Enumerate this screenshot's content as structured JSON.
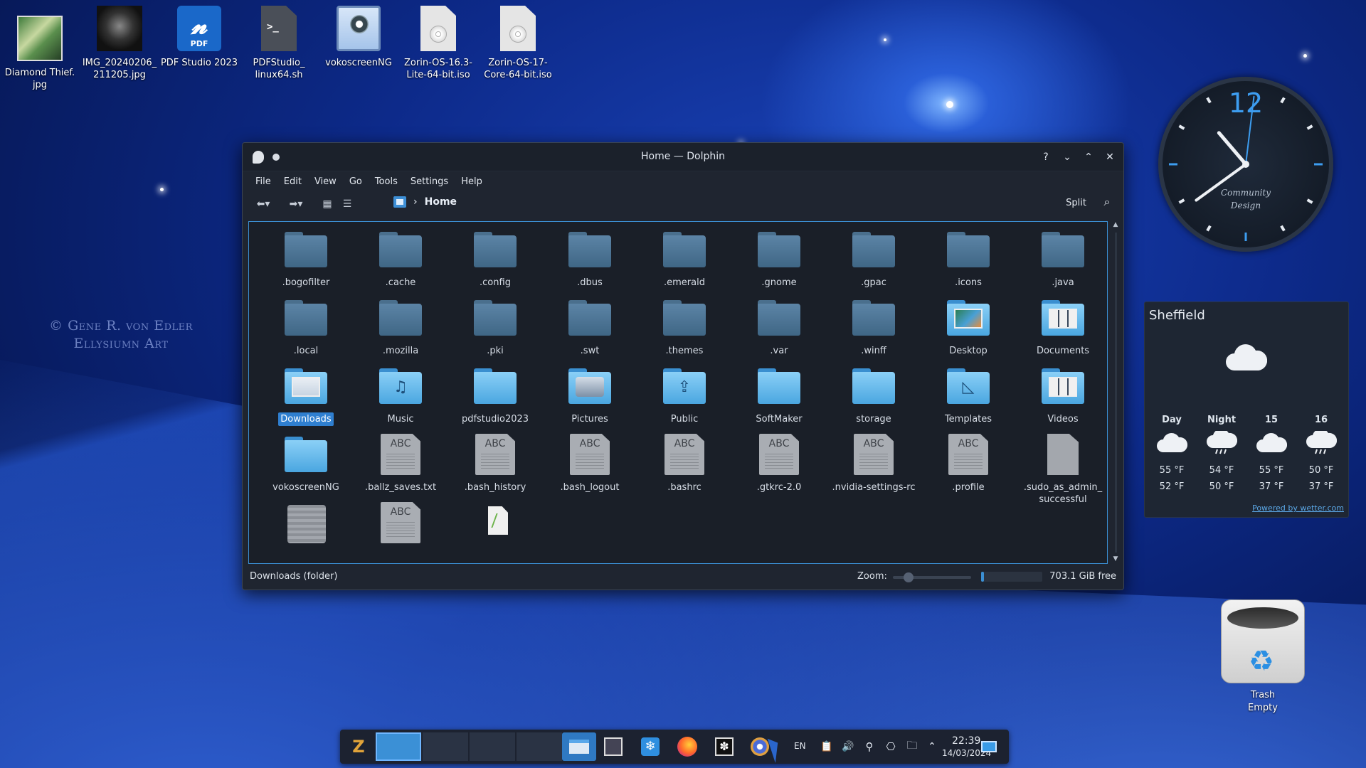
{
  "desktop": {
    "icons": [
      {
        "label": "Diamond Thief.\njpg",
        "kind": "photo-icon"
      },
      {
        "label": "IMG_20240206_\n211205.jpg",
        "kind": "photo-icon"
      },
      {
        "label": "PDF Studio 2023",
        "kind": "pdf-app-icon",
        "badge": "PDF",
        "glyph": "𝓷"
      },
      {
        "label": "PDFStudio_\nlinux64.sh",
        "kind": "script-icon",
        "glyph": ">_"
      },
      {
        "label": "vokoscreenNG",
        "kind": "screen-recorder-icon"
      },
      {
        "label": "Zorin-OS-16.3-\nLite-64-bit.iso",
        "kind": "disc-image-icon"
      },
      {
        "label": "Zorin-OS-17-\nCore-64-bit.iso",
        "kind": "disc-image-icon"
      }
    ],
    "watermark_line1": "© Gene R. von Edler",
    "watermark_line2": "Ellysiumn Art"
  },
  "clock": {
    "numeral": "12",
    "brand_line1": "Community",
    "brand_line2": "Design",
    "time_hours": 22,
    "time_minutes": 39,
    "accent": "#3d9df0"
  },
  "weather": {
    "city": "Sheffield",
    "current_icon": "cloud-icon",
    "forecast": [
      {
        "label": "Day",
        "icon": "cloud-icon",
        "high": "55 °F",
        "low": "52 °F"
      },
      {
        "label": "Night",
        "icon": "rain-cloud-icon",
        "high": "54 °F",
        "low": "50 °F"
      },
      {
        "label": "15",
        "icon": "cloud-icon",
        "high": "55 °F",
        "low": "37 °F"
      },
      {
        "label": "16",
        "icon": "rain-cloud-icon",
        "high": "50 °F",
        "low": "37 °F"
      }
    ],
    "powered": "Powered by wetter.com"
  },
  "trash": {
    "label": "Trash",
    "status": "Empty"
  },
  "window": {
    "title": "Home — Dolphin",
    "controls": [
      "?",
      "⌄",
      "⌃",
      "✕"
    ],
    "menu": [
      "File",
      "Edit",
      "View",
      "Go",
      "Tools",
      "Settings",
      "Help"
    ],
    "breadcrumb": "Home",
    "split_label": "Split",
    "items": [
      {
        "name": ".bogofilter",
        "type": "folder-dim"
      },
      {
        "name": ".cache",
        "type": "folder-dim"
      },
      {
        "name": ".config",
        "type": "folder-dim"
      },
      {
        "name": ".dbus",
        "type": "folder-dim"
      },
      {
        "name": ".emerald",
        "type": "folder-dim"
      },
      {
        "name": ".gnome",
        "type": "folder-dim"
      },
      {
        "name": ".gpac",
        "type": "folder-dim"
      },
      {
        "name": ".icons",
        "type": "folder-dim"
      },
      {
        "name": ".java",
        "type": "folder-dim"
      },
      {
        "name": ".local",
        "type": "folder-dim"
      },
      {
        "name": ".mozilla",
        "type": "folder-dim"
      },
      {
        "name": ".pki",
        "type": "folder-dim"
      },
      {
        "name": ".swt",
        "type": "folder-dim"
      },
      {
        "name": ".themes",
        "type": "folder-dim"
      },
      {
        "name": ".var",
        "type": "folder-dim"
      },
      {
        "name": ".winff",
        "type": "folder-dim"
      },
      {
        "name": "Desktop",
        "type": "folder-desktop"
      },
      {
        "name": "Documents",
        "type": "folder-documents"
      },
      {
        "name": "Downloads",
        "type": "folder-downloads",
        "selected": true
      },
      {
        "name": "Music",
        "type": "folder-music"
      },
      {
        "name": "pdfstudio2023",
        "type": "folder"
      },
      {
        "name": "Pictures",
        "type": "folder-pictures"
      },
      {
        "name": "Public",
        "type": "folder-public"
      },
      {
        "name": "SoftMaker",
        "type": "folder"
      },
      {
        "name": "storage",
        "type": "folder"
      },
      {
        "name": "Templates",
        "type": "folder-templates"
      },
      {
        "name": "Videos",
        "type": "folder-videos"
      },
      {
        "name": "vokoscreenNG",
        "type": "folder"
      },
      {
        "name": ".ballz_saves.txt",
        "type": "text"
      },
      {
        "name": ".bash_history",
        "type": "text"
      },
      {
        "name": ".bash_logout",
        "type": "text"
      },
      {
        "name": ".bashrc",
        "type": "text"
      },
      {
        "name": ".gtkrc-2.0",
        "type": "text"
      },
      {
        "name": ".nvidia-settings-rc",
        "type": "text"
      },
      {
        "name": ".profile",
        "type": "text"
      },
      {
        "name": ".sudo_as_admin_\nsuccessful",
        "type": "blank"
      },
      {
        "name": "",
        "type": "archive"
      },
      {
        "name": "",
        "type": "text"
      },
      {
        "name": "",
        "type": "script"
      }
    ],
    "text_icon_label": "ABC",
    "status_left": "Downloads (folder)",
    "zoom_label": "Zoom:",
    "zoom_level": 0.2,
    "free_space": "703.1 GiB free",
    "disk_used_fraction": 0.05
  },
  "taskbar": {
    "language": "EN",
    "time": "22:39",
    "date": "14/03/2024",
    "apps": [
      "zorin-menu-icon",
      "file-manager-icon",
      "screenshot-icon",
      "kde-store-icon",
      "firefox-icon",
      "kdenlive-icon",
      "browser-icon"
    ],
    "tray": [
      "clipboard-icon",
      "volume-icon",
      "location-icon",
      "mouse-icon",
      "folder-icon",
      "expand-tray-icon"
    ]
  },
  "colors": {
    "accent": "#3b8fd3",
    "selection": "#2f7fd0",
    "window_bg": "#1f2530"
  }
}
